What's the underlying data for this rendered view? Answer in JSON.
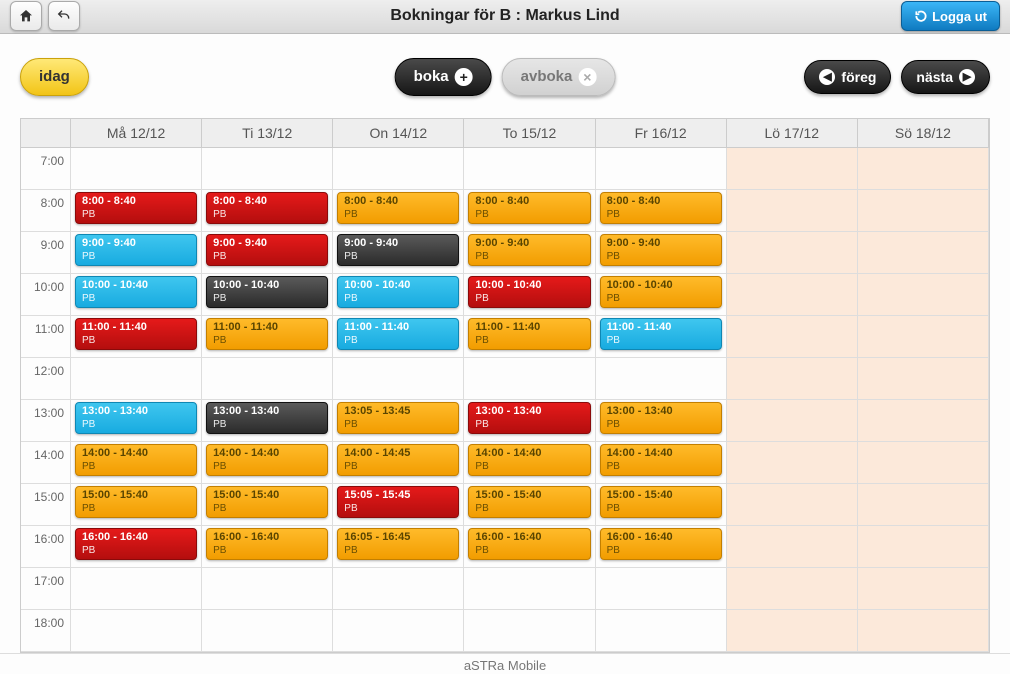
{
  "header": {
    "title": "Bokningar för B : Markus Lind",
    "logout": "Logga ut"
  },
  "toolbar": {
    "today": "idag",
    "book": "boka",
    "cancel": "avboka",
    "prev": "föreg",
    "next": "nästa"
  },
  "hours": [
    "7:00",
    "8:00",
    "9:00",
    "10:00",
    "11:00",
    "12:00",
    "13:00",
    "14:00",
    "15:00",
    "16:00",
    "17:00",
    "18:00"
  ],
  "days": [
    {
      "label": "Må 12/12",
      "weekend": false
    },
    {
      "label": "Ti 13/12",
      "weekend": false
    },
    {
      "label": "On 14/12",
      "weekend": false
    },
    {
      "label": "To 15/12",
      "weekend": false
    },
    {
      "label": "Fr 16/12",
      "weekend": false
    },
    {
      "label": "Lö 17/12",
      "weekend": true
    },
    {
      "label": "Sö 18/12",
      "weekend": true
    }
  ],
  "events": {
    "0": {
      "1": {
        "time": "8:00 - 8:40",
        "label": "PB",
        "color": "red"
      },
      "2": {
        "time": "9:00 - 9:40",
        "label": "PB",
        "color": "cyan"
      },
      "3": {
        "time": "10:00 - 10:40",
        "label": "PB",
        "color": "cyan"
      },
      "4": {
        "time": "11:00 - 11:40",
        "label": "PB",
        "color": "red"
      },
      "6": {
        "time": "13:00 - 13:40",
        "label": "PB",
        "color": "cyan"
      },
      "7": {
        "time": "14:00 - 14:40",
        "label": "PB",
        "color": "amber"
      },
      "8": {
        "time": "15:00 - 15:40",
        "label": "PB",
        "color": "amber"
      },
      "9": {
        "time": "16:00 - 16:40",
        "label": "PB",
        "color": "red"
      }
    },
    "1": {
      "1": {
        "time": "8:00 - 8:40",
        "label": "PB",
        "color": "red"
      },
      "2": {
        "time": "9:00 - 9:40",
        "label": "PB",
        "color": "red"
      },
      "3": {
        "time": "10:00 - 10:40",
        "label": "PB",
        "color": "dark"
      },
      "4": {
        "time": "11:00 - 11:40",
        "label": "PB",
        "color": "amber"
      },
      "6": {
        "time": "13:00 - 13:40",
        "label": "PB",
        "color": "dark"
      },
      "7": {
        "time": "14:00 - 14:40",
        "label": "PB",
        "color": "amber"
      },
      "8": {
        "time": "15:00 - 15:40",
        "label": "PB",
        "color": "amber"
      },
      "9": {
        "time": "16:00 - 16:40",
        "label": "PB",
        "color": "amber"
      }
    },
    "2": {
      "1": {
        "time": "8:00 - 8:40",
        "label": "PB",
        "color": "amber"
      },
      "2": {
        "time": "9:00 - 9:40",
        "label": "PB",
        "color": "dark"
      },
      "3": {
        "time": "10:00 - 10:40",
        "label": "PB",
        "color": "cyan"
      },
      "4": {
        "time": "11:00 - 11:40",
        "label": "PB",
        "color": "cyan"
      },
      "6": {
        "time": "13:05 - 13:45",
        "label": "PB",
        "color": "amber"
      },
      "7": {
        "time": "14:00 - 14:45",
        "label": "PB",
        "color": "amber"
      },
      "8": {
        "time": "15:05 - 15:45",
        "label": "PB",
        "color": "red"
      },
      "9": {
        "time": "16:05 - 16:45",
        "label": "PB",
        "color": "amber"
      }
    },
    "3": {
      "1": {
        "time": "8:00 - 8:40",
        "label": "PB",
        "color": "amber"
      },
      "2": {
        "time": "9:00 - 9:40",
        "label": "PB",
        "color": "amber"
      },
      "3": {
        "time": "10:00 - 10:40",
        "label": "PB",
        "color": "red"
      },
      "4": {
        "time": "11:00 - 11:40",
        "label": "PB",
        "color": "amber"
      },
      "6": {
        "time": "13:00 - 13:40",
        "label": "PB",
        "color": "red"
      },
      "7": {
        "time": "14:00 - 14:40",
        "label": "PB",
        "color": "amber"
      },
      "8": {
        "time": "15:00 - 15:40",
        "label": "PB",
        "color": "amber"
      },
      "9": {
        "time": "16:00 - 16:40",
        "label": "PB",
        "color": "amber"
      }
    },
    "4": {
      "1": {
        "time": "8:00 - 8:40",
        "label": "PB",
        "color": "amber"
      },
      "2": {
        "time": "9:00 - 9:40",
        "label": "PB",
        "color": "amber"
      },
      "3": {
        "time": "10:00 - 10:40",
        "label": "PB",
        "color": "amber"
      },
      "4": {
        "time": "11:00 - 11:40",
        "label": "PB",
        "color": "cyan"
      },
      "6": {
        "time": "13:00 - 13:40",
        "label": "PB",
        "color": "amber"
      },
      "7": {
        "time": "14:00 - 14:40",
        "label": "PB",
        "color": "amber"
      },
      "8": {
        "time": "15:00 - 15:40",
        "label": "PB",
        "color": "amber"
      },
      "9": {
        "time": "16:00 - 16:40",
        "label": "PB",
        "color": "amber"
      }
    }
  },
  "footer": "aSTRa Mobile"
}
